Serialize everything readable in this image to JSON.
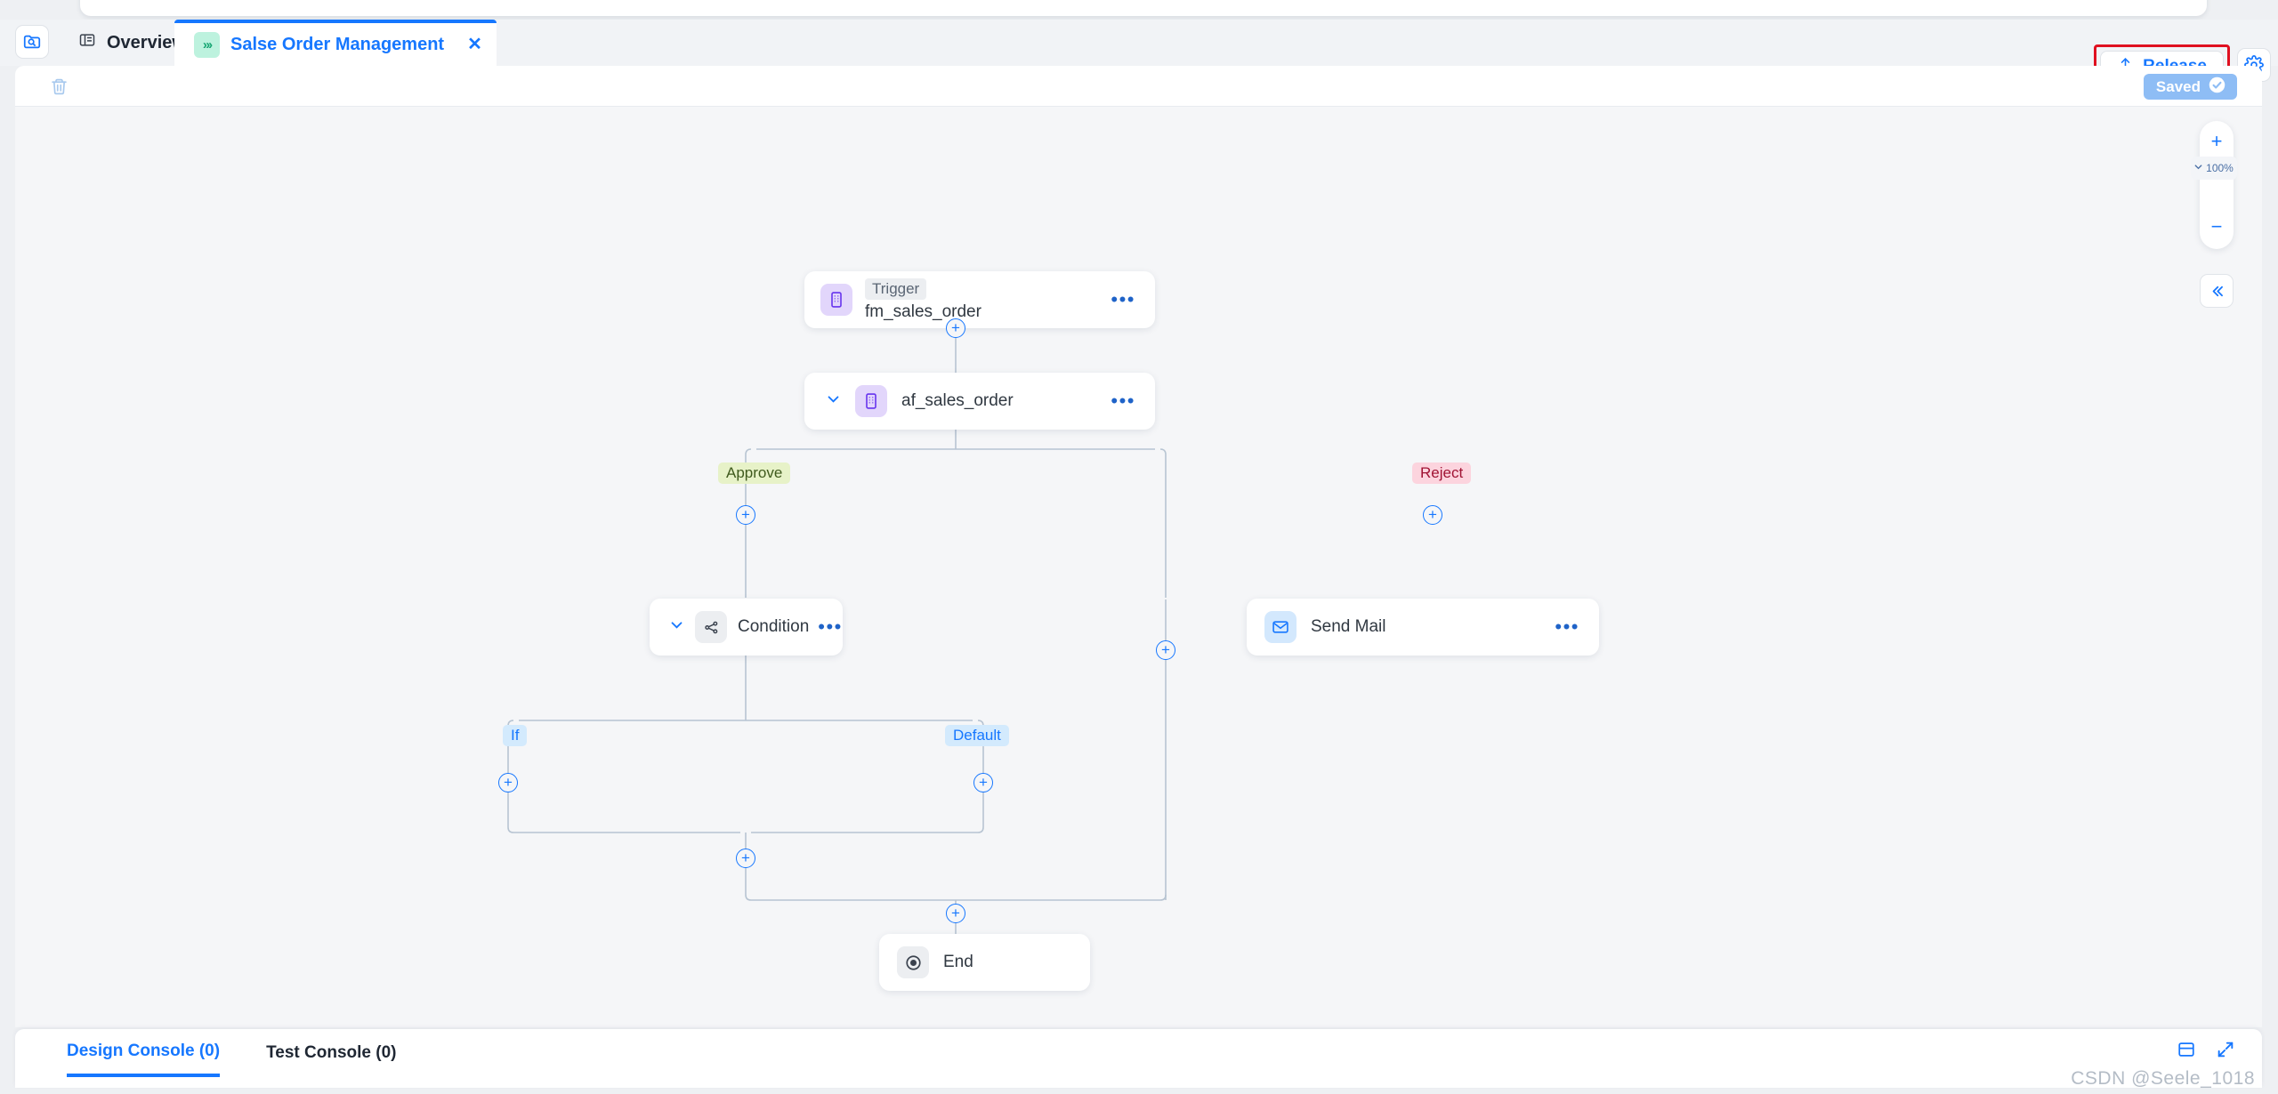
{
  "tabbar": {
    "search_icon": "folder-search-icon",
    "tabs": [
      {
        "label": "Overview",
        "icon": "list-panel-icon",
        "active": false
      },
      {
        "label": "Salse Order Management",
        "icon": "chevrons-right-icon",
        "active": true,
        "close": "✕"
      }
    ]
  },
  "header": {
    "release_label": "Release",
    "release_icon": "upload-arrow-icon",
    "release_highlight_color": "#e01020",
    "gear_icon": "gear-icon"
  },
  "toolbar": {
    "trash_icon": "trash-icon",
    "saved_label": "Saved",
    "saved_icon": "check-circle-icon",
    "saved_color": "#8ebdf5"
  },
  "canvas": {
    "zoom": {
      "plus": "+",
      "level": "100%",
      "chevron": "⌄",
      "minus": "−"
    },
    "collapse_label": "«",
    "nodes": [
      {
        "id": "trigger",
        "tag": "Trigger",
        "name": "fm_sales_order",
        "icon": "form-icon",
        "icon_color": "#e2d6fb",
        "dots": "•••"
      },
      {
        "id": "af_sales_order",
        "label": "af_sales_order",
        "icon": "form-icon",
        "icon_color": "#e2d6fb",
        "chevron": "⌄",
        "dots": "•••"
      },
      {
        "id": "condition",
        "label": "Condition",
        "icon": "branch-icon",
        "icon_color": "#eceef1",
        "chevron": "⌄",
        "dots": "•••"
      },
      {
        "id": "send_mail",
        "label": "Send Mail",
        "icon": "envelope-icon",
        "icon_color": "#d3e8fd",
        "dots": "•••"
      },
      {
        "id": "end",
        "label": "End",
        "icon": "end-circle-icon",
        "icon_color": "#eceef1"
      }
    ],
    "branch_labels": [
      {
        "id": "approve",
        "text": "Approve",
        "bg": "#e7f2c8",
        "fg": "#3f5a1d"
      },
      {
        "id": "reject",
        "text": "Reject",
        "bg": "#fcd4de",
        "fg": "#a01233"
      },
      {
        "id": "if",
        "text": "If",
        "bg": "#d3eafd",
        "fg": "#1677ff"
      },
      {
        "id": "default",
        "text": "Default",
        "bg": "#d3eafd",
        "fg": "#1677ff"
      }
    ],
    "add_handle": "+"
  },
  "console": {
    "tabs": [
      {
        "label": "Design Console (0)",
        "active": true
      },
      {
        "label": "Test Console (0)",
        "active": false
      }
    ],
    "icons": [
      "panel-layout-icon",
      "fullscreen-expand-icon"
    ]
  },
  "watermark": "CSDN @Seele_1018"
}
